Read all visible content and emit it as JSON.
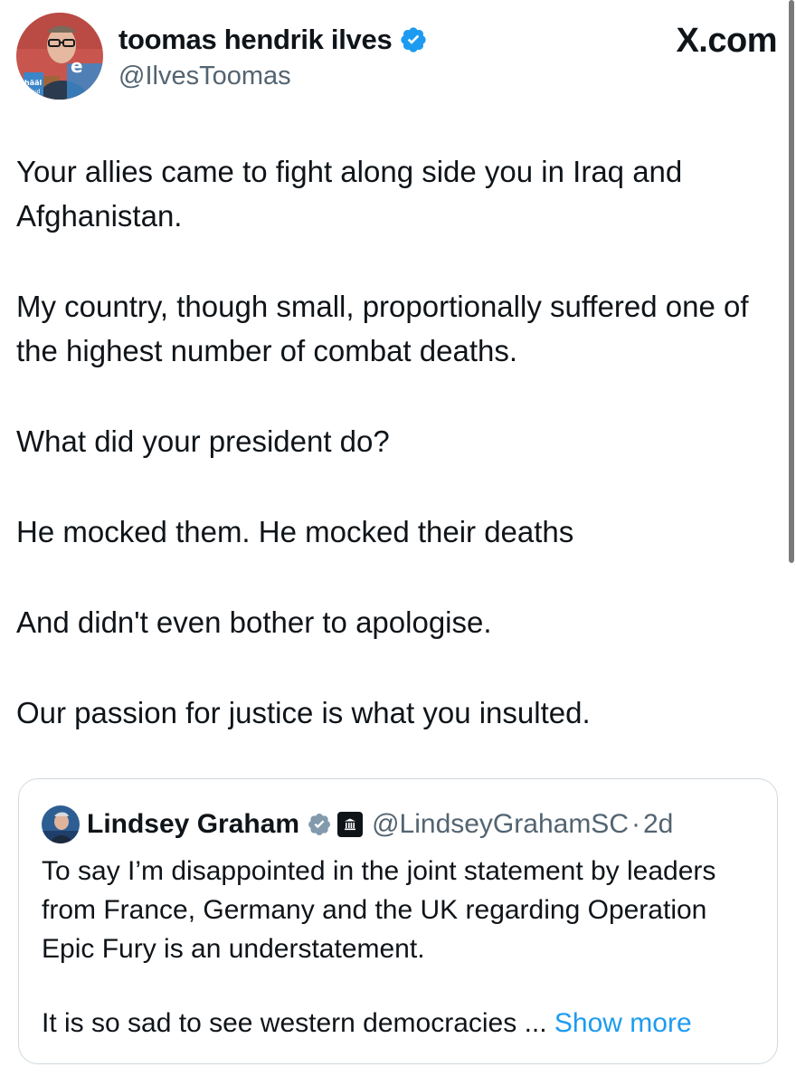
{
  "site": {
    "logo_text": "X.com"
  },
  "author": {
    "display_name": "toomas hendrik ilves",
    "handle": "@IlvesToomas",
    "verified": true,
    "verified_color": "#1d9bf0",
    "avatar_badge": "e",
    "avatar_text_line1": "hääl",
    "avatar_text_line2": "antud"
  },
  "tweet": {
    "paragraphs": [
      "Your allies came to fight along side you in Iraq and Afghanistan.",
      "My country, though small, proportionally suffered one of the highest number of combat deaths.",
      "What did your president do?",
      "He mocked them. He mocked their deaths",
      "And didn't even bother to apologise.",
      "Our passion for justice is what you insulted."
    ]
  },
  "quote": {
    "display_name": "Lindsey Graham",
    "verified": true,
    "verified_color": "#829aab",
    "government_badge_icon": "government-building-icon",
    "handle": "@LindseyGrahamSC",
    "separator": "·",
    "time": "2d",
    "paragraph_1": "To say I’m disappointed in the joint statement by leaders from France, Germany and the UK regarding Operation Epic Fury is an understatement.",
    "paragraph_2": "It is so sad to see western democracies ...",
    "show_more_label": "Show more",
    "link_color": "#1d9bf0"
  }
}
